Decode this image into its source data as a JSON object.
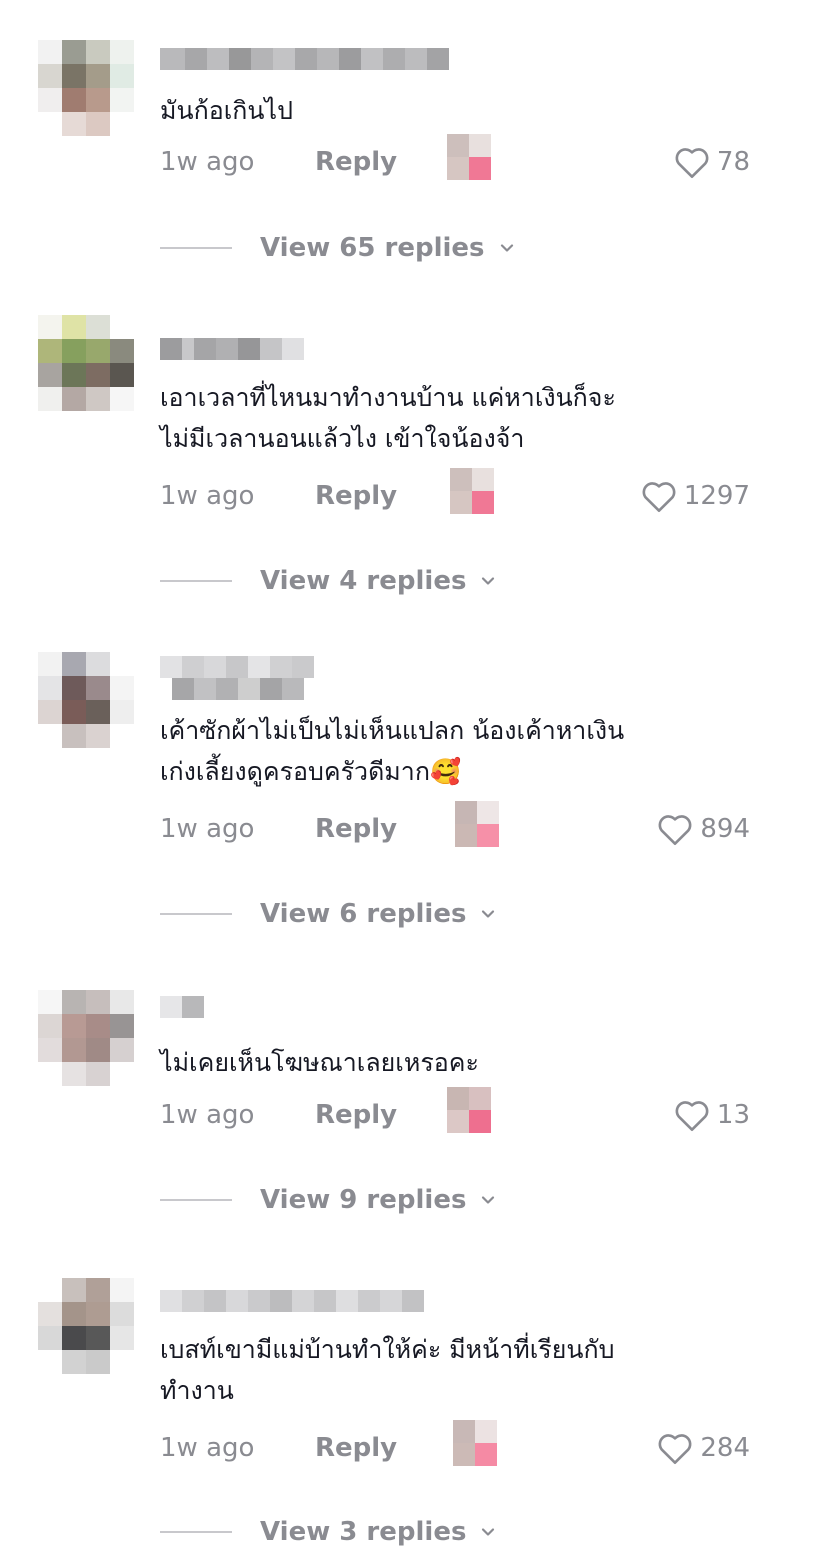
{
  "comments": [
    {
      "text_lines": [
        "มันก้อเกินไป"
      ],
      "time": "1w ago",
      "reply_label": "Reply",
      "likes": "78",
      "view_replies": "View 65 replies"
    },
    {
      "text_lines": [
        "เอาเวลาที่ไหนมาทำงานบ้าน แค่หาเงินก็จะ",
        "ไม่มีเวลานอนแล้วไง เข้าใจน้องจ้า"
      ],
      "time": "1w ago",
      "reply_label": "Reply",
      "likes": "1297",
      "view_replies": "View 4 replies"
    },
    {
      "text_lines": [
        "เค้าซักผ้าไม่เป็นไม่เห็นแปลก น้องเค้าหาเงิน",
        "เก่งเลี้ยงดูครอบครัวดีมาก🥰"
      ],
      "time": "1w ago",
      "reply_label": "Reply",
      "likes": "894",
      "view_replies": "View 6 replies"
    },
    {
      "text_lines": [
        "ไม่เคยเห็นโฆษณาเลยเหรอคะ"
      ],
      "time": "1w ago",
      "reply_label": "Reply",
      "likes": "13",
      "view_replies": "View 9 replies"
    },
    {
      "text_lines": [
        "เบสท์เขามีแม่บ้านทำให้ค่ะ มีหน้าที่เรียนกับ",
        "ทำงาน"
      ],
      "time": "1w ago",
      "reply_label": "Reply",
      "likes": "284",
      "view_replies": "View 3 replies"
    }
  ],
  "icons": {
    "like": "heart-outline-icon",
    "expand": "chevron-down-icon",
    "creator_liked": "creator-avatar-badge"
  },
  "colors": {
    "text": "#161823",
    "muted": "#8a8b91",
    "divider": "#c8c8cc",
    "badge_pink": "#f26d8f"
  }
}
